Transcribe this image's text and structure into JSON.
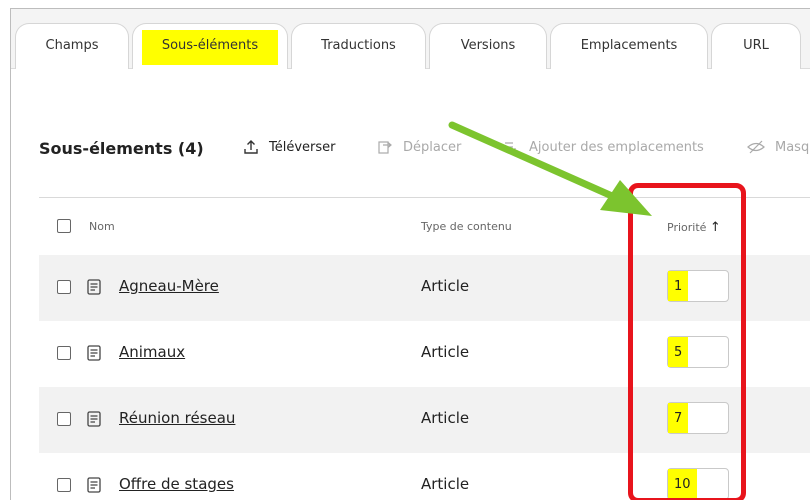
{
  "tabs": [
    {
      "label": "Champs",
      "active": false
    },
    {
      "label": "Sous-éléments",
      "active": true
    },
    {
      "label": "Traductions",
      "active": false
    },
    {
      "label": "Versions",
      "active": false
    },
    {
      "label": "Emplacements",
      "active": false
    },
    {
      "label": "URL",
      "active": false
    }
  ],
  "header": {
    "title": "Sous-élements (4)",
    "actions": {
      "upload": "Téléverser",
      "move": "Déplacer",
      "add_locations": "Ajouter des emplacements",
      "hide": "Masq"
    }
  },
  "table": {
    "columns": {
      "name": "Nom",
      "content_type": "Type de contenu",
      "priority": "Priorité",
      "priority_sort": "↑"
    },
    "rows": [
      {
        "name": "Agneau-Mère",
        "type": "Article",
        "priority": "1"
      },
      {
        "name": "Animaux",
        "type": "Article",
        "priority": "5"
      },
      {
        "name": "Réunion réseau",
        "type": "Article",
        "priority": "7"
      },
      {
        "name": "Offre de stages",
        "type": "Article",
        "priority": "10"
      }
    ]
  },
  "colors": {
    "highlight": "#ffff00",
    "annotation_box": "#e8141c",
    "annotation_arrow": "#7cc42e",
    "row_alt_bg": "#f2f2f2"
  }
}
